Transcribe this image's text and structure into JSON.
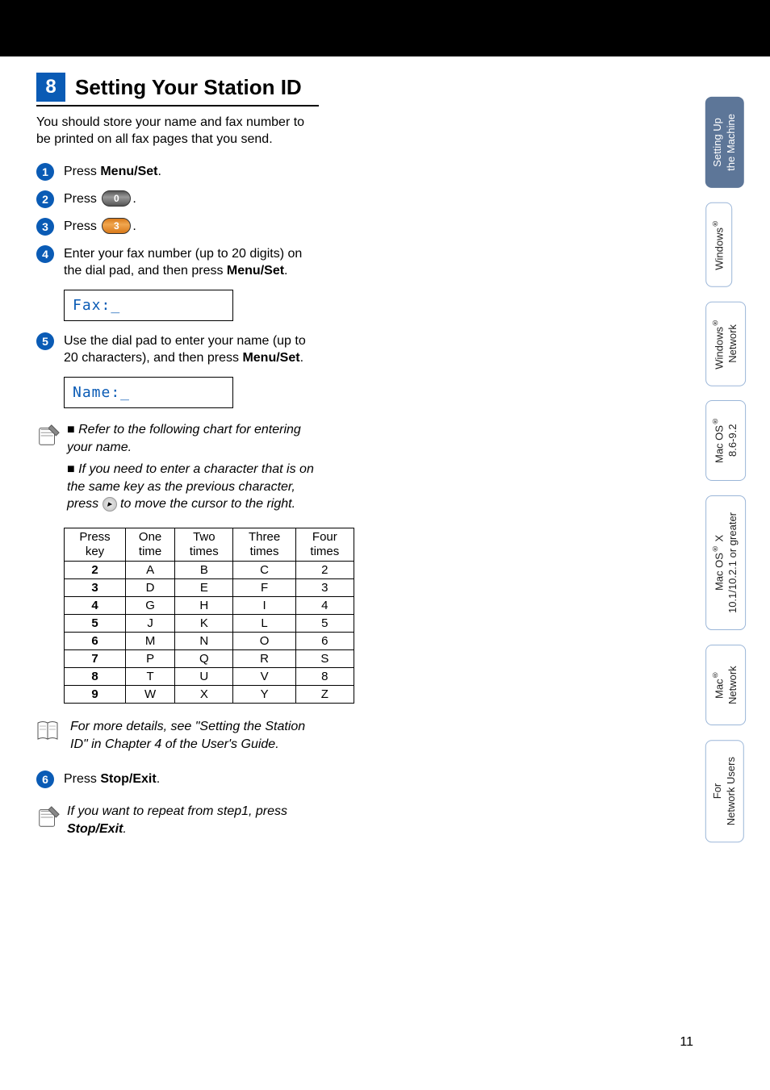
{
  "section": {
    "number": "8",
    "title": "Setting Your Station ID"
  },
  "intro": "You should store your name and fax number to be printed on all fax pages that you send.",
  "steps": {
    "s1": {
      "pre": "Press ",
      "bold": "Menu/Set",
      "post": "."
    },
    "s2": {
      "pre": "Press ",
      "key": "0",
      "post": "."
    },
    "s3": {
      "pre": "Press ",
      "key": "3",
      "post": "."
    },
    "s4": {
      "text_a": "Enter your fax number (up to 20 digits) on the dial pad, and then press ",
      "bold": "Menu/Set",
      "text_b": "."
    },
    "s5": {
      "text_a": "Use the dial pad to enter your name (up to 20 characters), and then press ",
      "bold": "Menu/Set",
      "text_b": "."
    },
    "s6": {
      "pre": "Press ",
      "bold": "Stop/Exit",
      "post": "."
    }
  },
  "lcd": {
    "fax": "Fax:_",
    "name": "Name:_"
  },
  "notes": {
    "chart": "Refer to the following chart for entering your name.",
    "samekey_a": "If you need to enter a character that is on the same key as the previous character,",
    "samekey_b_pre": "press ",
    "samekey_b_post": " to move the cursor to the right."
  },
  "table": {
    "headers": [
      "Press key",
      "One time",
      "Two times",
      "Three times",
      "Four times"
    ],
    "rows": [
      {
        "key": "2",
        "c1": "A",
        "c2": "B",
        "c3": "C",
        "c4": "2"
      },
      {
        "key": "3",
        "c1": "D",
        "c2": "E",
        "c3": "F",
        "c4": "3"
      },
      {
        "key": "4",
        "c1": "G",
        "c2": "H",
        "c3": "I",
        "c4": "4"
      },
      {
        "key": "5",
        "c1": "J",
        "c2": "K",
        "c3": "L",
        "c4": "5"
      },
      {
        "key": "6",
        "c1": "M",
        "c2": "N",
        "c3": "O",
        "c4": "6"
      },
      {
        "key": "7",
        "c1": "P",
        "c2": "Q",
        "c3": "R",
        "c4": "S"
      },
      {
        "key": "8",
        "c1": "T",
        "c2": "U",
        "c3": "V",
        "c4": "8"
      },
      {
        "key": "9",
        "c1": "W",
        "c2": "X",
        "c3": "Y",
        "c4": "Z"
      }
    ]
  },
  "reference": "For more details, see \"Setting the Station ID\" in Chapter 4 of the User's Guide.",
  "repeat_note_a": "If you want to repeat from step1, press ",
  "repeat_note_b": "Stop/Exit",
  "repeat_note_c": ".",
  "side_tabs": {
    "t1a": "Setting Up",
    "t1b": "the Machine",
    "t2": "Windows",
    "t3a": "Windows",
    "t3b": "Network",
    "t4a": "Mac OS",
    "t4b": "8.6-9.2",
    "t5a": "Mac OS",
    "t5b": " X",
    "t5c": "10.1/10.2.1 or greater",
    "t6a": "Mac",
    "t6b": "Network",
    "t7a": "For",
    "t7b": "Network Users"
  },
  "page_number": "11"
}
